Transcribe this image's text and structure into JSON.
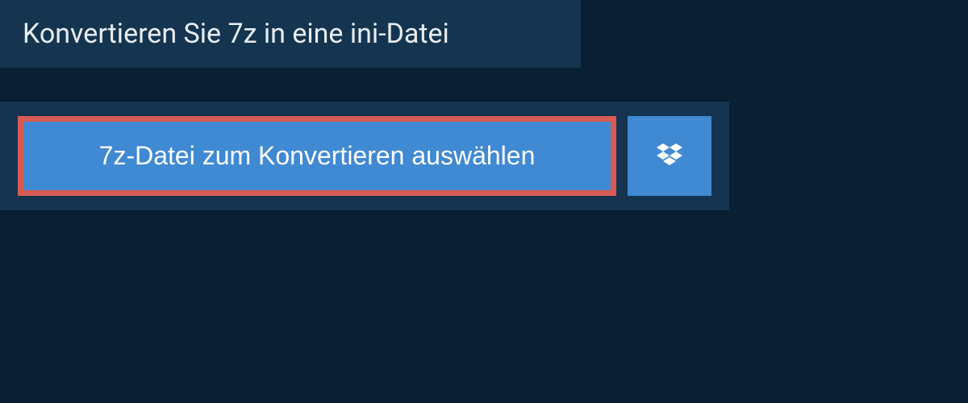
{
  "header": {
    "title": "Konvertieren Sie 7z in eine ini-Datei"
  },
  "upload": {
    "select_label": "7z-Datei zum Konvertieren auswählen"
  },
  "colors": {
    "background": "#0a1f33",
    "panel": "#14344f",
    "button": "#4089d3",
    "highlight_border": "#d85a52",
    "text_light": "#e8edf2",
    "text_white": "#ffffff"
  }
}
